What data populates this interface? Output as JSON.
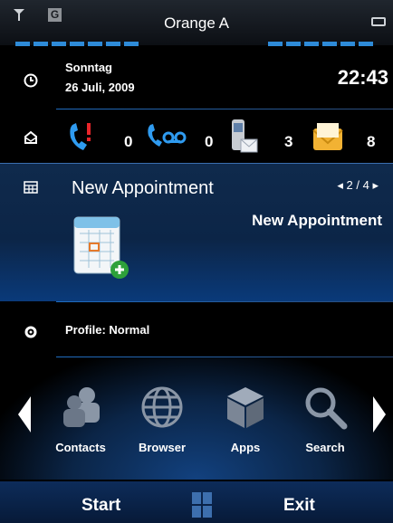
{
  "status": {
    "carrier": "Orange A",
    "network_type": "G"
  },
  "date": {
    "weekday": "Sonntag",
    "date": "26 Juli, 2009",
    "time": "22:43"
  },
  "notifications": [
    {
      "icon": "missed-call-icon",
      "count": "0"
    },
    {
      "icon": "voicemail-icon",
      "count": "0"
    },
    {
      "icon": "sms-icon",
      "count": "3"
    },
    {
      "icon": "email-icon",
      "count": "8"
    }
  ],
  "appointment": {
    "title": "New Appointment",
    "pager": "◂ 2 / 4 ▸",
    "subtitle": "New Appointment"
  },
  "profile": {
    "label": "Profile: Normal"
  },
  "apps": [
    {
      "label": "Contacts",
      "icon": "contacts-icon"
    },
    {
      "label": "Browser",
      "icon": "browser-icon"
    },
    {
      "label": "Apps",
      "icon": "apps-icon"
    },
    {
      "label": "Search",
      "icon": "search-icon"
    }
  ],
  "softkeys": {
    "left": "Start",
    "right": "Exit"
  },
  "colors": {
    "accent": "#2e8bd8",
    "panel": "#0c2547",
    "background": "#000000"
  }
}
